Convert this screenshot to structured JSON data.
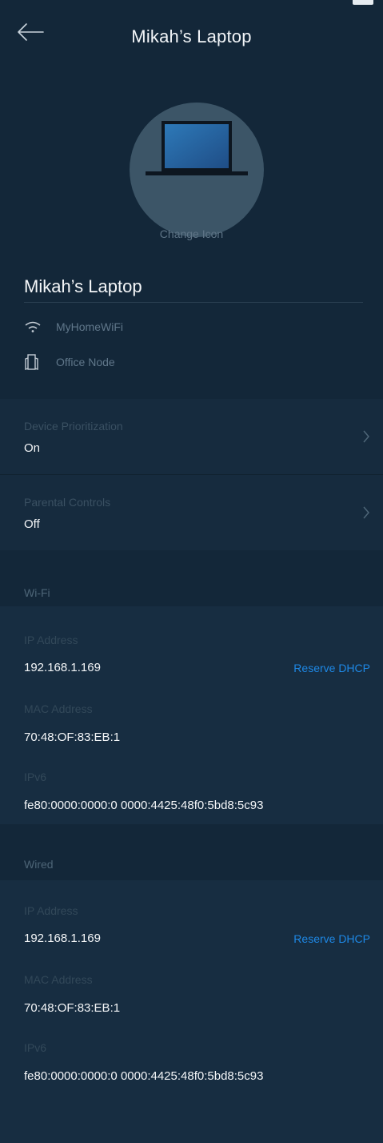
{
  "header": {
    "title": "Mikah’s Laptop"
  },
  "device": {
    "change_icon_label": "Change Icon",
    "name": "Mikah’s Laptop",
    "network": "MyHomeWiFi",
    "node": "Office Node"
  },
  "settings": {
    "prioritization": {
      "label": "Device Prioritization",
      "value": "On"
    },
    "parental": {
      "label": "Parental Controls",
      "value": "Off"
    }
  },
  "wifi": {
    "section_title": "Wi-Fi",
    "ip_label": "IP Address",
    "ip_value": "192.168.1.169",
    "reserve_label": "Reserve DHCP",
    "mac_label": "MAC Address",
    "mac_value": "70:48:OF:83:EB:1",
    "ipv6_label": "IPv6",
    "ipv6_value": "fe80:0000:0000:0 0000:4425:48f0:5bd8:5c93"
  },
  "wired": {
    "section_title": "Wired",
    "ip_label": "IP Address",
    "ip_value": "192.168.1.169",
    "reserve_label": "Reserve DHCP",
    "mac_label": "MAC Address",
    "mac_value": "70:48:OF:83:EB:1",
    "ipv6_label": "IPv6",
    "ipv6_value": "fe80:0000:0000:0 0000:4425:48f0:5bd8:5c93"
  },
  "colors": {
    "background": "#132739",
    "accent_link": "#1e88e5"
  },
  "icons": [
    "back-arrow-icon",
    "laptop-icon",
    "wifi-icon",
    "node-icon",
    "chevron-right-icon"
  ]
}
